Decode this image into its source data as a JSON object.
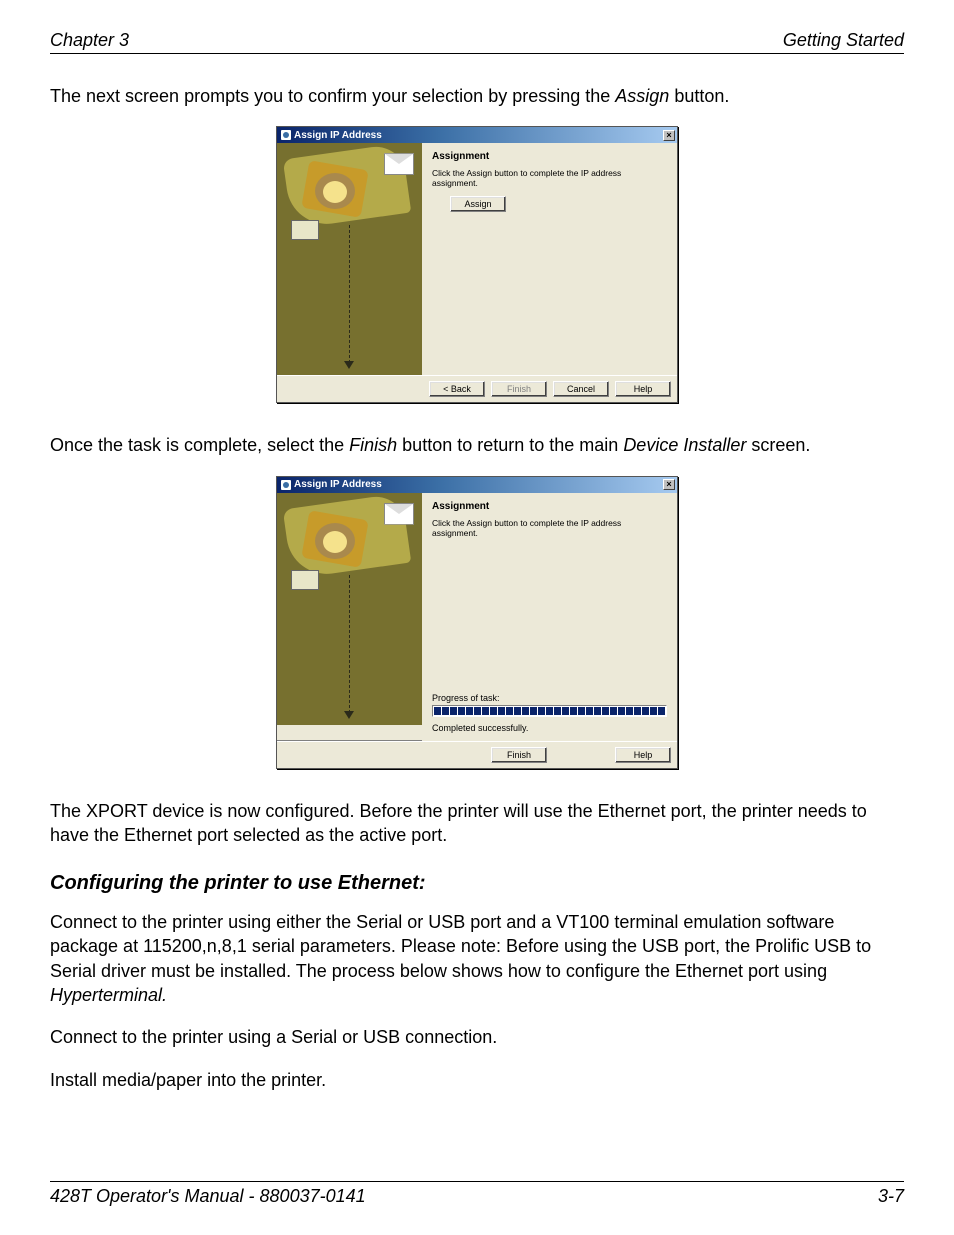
{
  "header": {
    "left": "Chapter 3",
    "right": "Getting Started"
  },
  "para1_a": "The next screen prompts you to confirm your selection by pressing the ",
  "para1_b": "Assign",
  "para1_c": " button.",
  "dialog1": {
    "title": "Assign IP Address",
    "close_glyph": "×",
    "section": "Assignment",
    "instruction": "Click the Assign button to complete the IP address assignment.",
    "assign": "Assign",
    "back": "< Back",
    "finish": "Finish",
    "cancel": "Cancel",
    "help": "Help"
  },
  "para2_a": "Once the task is complete, select the ",
  "para2_b": "Finish",
  "para2_c": " button to return to the main ",
  "para2_d": "Device Installer",
  "para2_e": " screen.",
  "dialog2": {
    "title": "Assign IP Address",
    "close_glyph": "×",
    "section": "Assignment",
    "instruction": "Click the Assign button to complete the IP address assignment.",
    "progress_label": "Progress of task:",
    "completed": "Completed successfully.",
    "finish": "Finish",
    "help": "Help"
  },
  "para3": "The XPORT device is now configured.  Before the printer will use the Ethernet port, the printer needs to have the Ethernet port selected as the active port.",
  "subheading": "Configuring the printer to use Ethernet:",
  "para4_a": "Connect to the printer using either the Serial or USB port and a VT100 terminal emulation software package at 115200,n,8,1 serial parameters.  Please note:  Before using the USB port, the Prolific USB to Serial driver must be installed.  The process below shows how to configure the Ethernet port using ",
  "para4_b": "Hyperterminal.",
  "para5": "Connect to the printer using a Serial or USB connection.",
  "para6": "Install media/paper into the printer.",
  "footer": {
    "left": "428T Operator's Manual - 880037-0141",
    "right": "3-7"
  }
}
